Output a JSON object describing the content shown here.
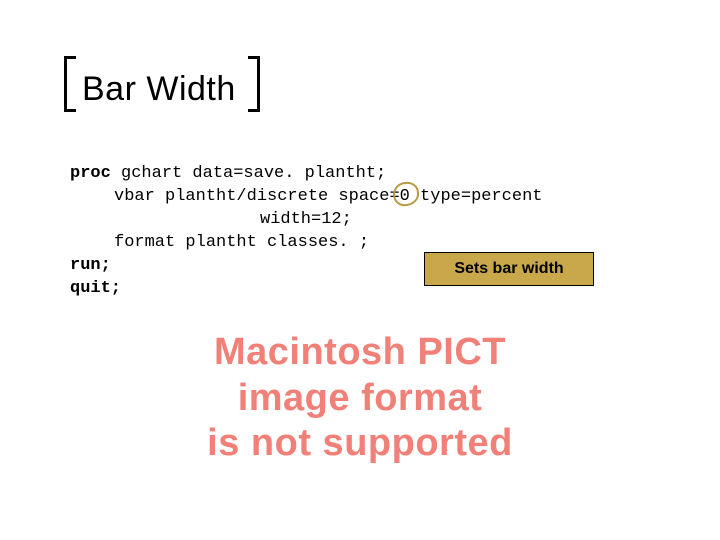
{
  "title": "Bar Width",
  "code": {
    "l1a": "proc",
    "l1b": " gchart data=save. plantht;",
    "l2a": "vbar plantht/discrete space=",
    "l2_zero": "0",
    "l2b": " type=percent",
    "l3": "width=12;",
    "l4": "format plantht classes. ;",
    "l5": "run;",
    "l6": "quit;"
  },
  "callout": "Sets bar width",
  "error": {
    "line1": "Macintosh PICT",
    "line2": "image format",
    "line3": "is not supported"
  }
}
